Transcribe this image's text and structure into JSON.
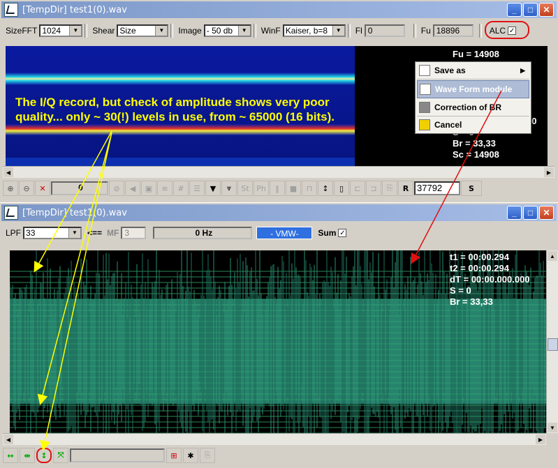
{
  "top_window": {
    "title": "[TempDir] test1(0).wav",
    "toolbar": {
      "sizefft_label": "SizeFFT",
      "sizefft_value": "1024",
      "shear_label": "Shear",
      "shear_value": "Size",
      "image_label": "Image",
      "image_value": "- 50 db",
      "winf_label": "WinF",
      "winf_value": "Kaiser, b=8",
      "fl_label": "Fl",
      "fl_value": "0",
      "fu_label": "Fu",
      "fu_value": "18896",
      "alc_label": "ALC",
      "alc_checked": "✓"
    },
    "readouts": [
      "Fu = 14908",
      "S = 0",
      "Br = 33,33",
      "Sc = 14908"
    ],
    "readout_partial": "00",
    "annotation": [
      "The I/Q record, but check of amplitude shows very poor",
      "quality... only ~ 30(!) levels in use, from ~ 65000 (16 bits)."
    ],
    "iconbar": {
      "value_field": "0",
      "r_label": "R",
      "r_value": "37792",
      "s_label": "S",
      "st_label": "St",
      "ph_label": "Ph"
    },
    "context_menu": [
      {
        "label": "Save as",
        "icon": "save-icon",
        "submenu": "▶"
      },
      {
        "label": "Wave Form module",
        "icon": "waveform-icon",
        "selected": true
      },
      {
        "label": "Correction of BR",
        "icon": "calculator-icon"
      },
      {
        "label": "Cancel",
        "icon": "cancel-icon"
      }
    ]
  },
  "bottom_window": {
    "title": "[TempDir] test1(0).wav",
    "toolbar": {
      "lpf_label": "LPF",
      "lpf_value": "33",
      "arrow_label": "<==",
      "mf_label": "MF",
      "mf_value": "3",
      "hz_value": "0 Hz",
      "vmw_label": "- VMW-",
      "sum_label": "Sum",
      "sum_checked": "✓"
    },
    "readouts": [
      "t1 = 00:00.294",
      "t2 = 00:00.294",
      "dT = 00:00.000.000",
      "S = 0",
      "Br = 33,33"
    ]
  },
  "colors": {
    "waveform": "#2a8f74",
    "annotation": "#ffff00",
    "arrow_red": "#e01010",
    "menu_selected": "#aebcd6"
  }
}
